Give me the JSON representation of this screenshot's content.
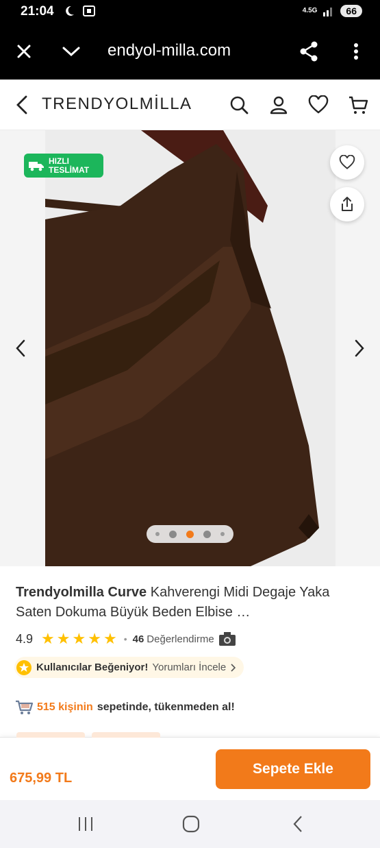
{
  "status_bar": {
    "time": "21:04",
    "network": "4.5G",
    "battery": "66"
  },
  "browser": {
    "url": "endyol-milla.com"
  },
  "header": {
    "brand": "TRENDYOLMİLLA"
  },
  "gallery": {
    "badge": {
      "line1": "HIZLI",
      "line2": "TESLİMAT"
    },
    "image_count": 4,
    "active_index": 2
  },
  "product": {
    "brand": "Trendyolmilla Curve",
    "name": " Kahverengi Midi Degaje Yaka Saten Dokuma Büyük Beden Elbise …",
    "rating": "4.9",
    "stars": 5,
    "review_count": "46",
    "review_label": "Değerlendirme",
    "liked_text": "Kullanıcılar Beğeniyor!",
    "reviews_link": "Yorumları İncele",
    "basket_count": "515 kişinin",
    "basket_text": "sepetinde, tükenmeden al!"
  },
  "purchase": {
    "price": "675,99 TL",
    "add_to_cart": "Sepete Ekle"
  },
  "colors": {
    "accent": "#f27a1a",
    "badge_green": "#1cb65b",
    "star": "#ffc000"
  }
}
